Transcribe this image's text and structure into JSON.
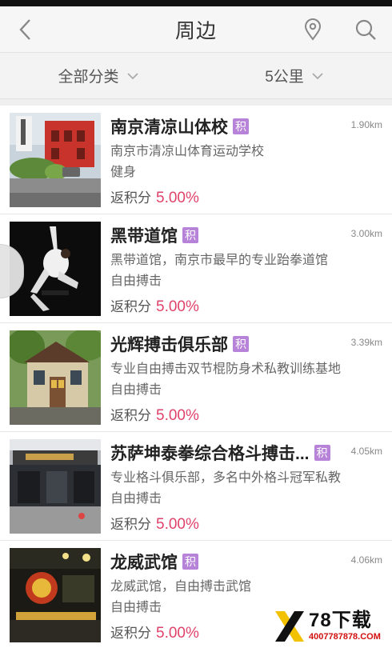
{
  "header": {
    "title": "周边",
    "back_icon": "chevron-left-icon",
    "location_icon": "map-pin-icon",
    "search_icon": "search-icon"
  },
  "filters": {
    "category": "全部分类",
    "distance": "5公里"
  },
  "badge_label": "积",
  "rebate_label": "返积分",
  "colors": {
    "accent": "#e0426a",
    "badge": "#b783d8",
    "header_bg": "#f6f6f6"
  },
  "items": [
    {
      "name": "南京清凉山体校",
      "distance": "1.90km",
      "desc": "南京市清凉山体育运动学校",
      "category": "健身",
      "rebate": "5.00%"
    },
    {
      "name": "黑带道馆",
      "distance": "3.00km",
      "desc": "黑带道馆，南京市最早的专业跆拳道馆",
      "category": "自由搏击",
      "rebate": "5.00%"
    },
    {
      "name": "光辉搏击俱乐部",
      "distance": "3.39km",
      "desc": "专业自由搏击双节棍防身术私教训练基地",
      "category": "自由搏击",
      "rebate": "5.00%"
    },
    {
      "name": "苏萨坤泰拳综合格斗搏击...",
      "distance": "4.05km",
      "desc": "专业格斗俱乐部，多名中外格斗冠军私教",
      "category": "自由搏击",
      "rebate": "5.00%"
    },
    {
      "name": "龙威武馆",
      "distance": "4.06km",
      "desc": "龙威武馆，自由搏击武馆",
      "category": "自由搏击",
      "rebate": "5.00%"
    }
  ],
  "watermark": {
    "main": "78下载",
    "sub": "4007787878.COM"
  }
}
